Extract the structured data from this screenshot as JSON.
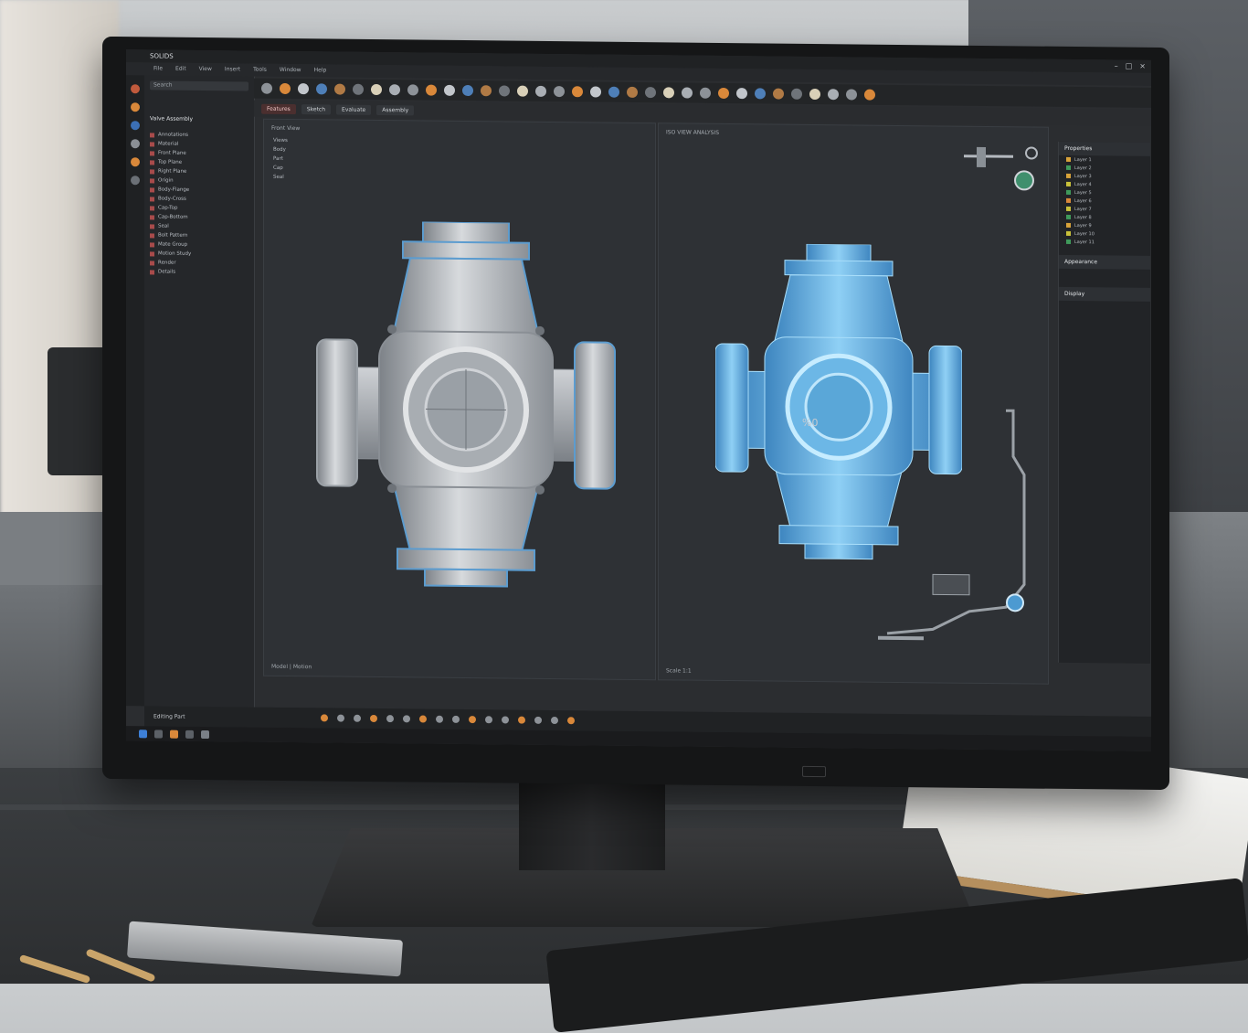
{
  "app": {
    "title": "SOLIDS",
    "menus": [
      "File",
      "Edit",
      "View",
      "Insert",
      "Tools",
      "Window",
      "Help"
    ]
  },
  "toolbar": {
    "tabs": [
      "Features",
      "Sketch",
      "Evaluate",
      "Assembly"
    ],
    "active_tab": 0
  },
  "browser": {
    "search_placeholder": "Search",
    "header": "Valve Assembly",
    "items": [
      "Annotations",
      "Material",
      "Front Plane",
      "Top Plane",
      "Right Plane",
      "Origin",
      "Body-Flange",
      "Body-Cross",
      "Cap-Top",
      "Cap-Bottom",
      "Seal",
      "Bolt Pattern",
      "Mate Group",
      "Motion Study",
      "Render",
      "Details"
    ]
  },
  "viewports": {
    "left_label": "Front View",
    "left_tree": [
      "Views",
      "Body",
      "Part",
      "Cap",
      "Seal"
    ],
    "right_label": "ISO VIEW ANALYSIS",
    "center_mark": "%0",
    "left_footer": "Model | Motion",
    "right_footer": "Scale 1:1"
  },
  "right_panel": {
    "title": "Properties",
    "rows": [
      "Layer 1",
      "Layer 2",
      "Layer 3",
      "Layer 4",
      "Layer 5",
      "Layer 6",
      "Layer 7",
      "Layer 8",
      "Layer 9",
      "Layer 10",
      "Layer 11"
    ],
    "section2": "Appearance",
    "section3": "Display"
  },
  "status": {
    "text": "Editing Part"
  },
  "colors": {
    "accent": "#d9883a",
    "part_metal": "#b8bcc1",
    "part_transparent": "#5aa9de",
    "screen_bg": "#2e3135"
  }
}
